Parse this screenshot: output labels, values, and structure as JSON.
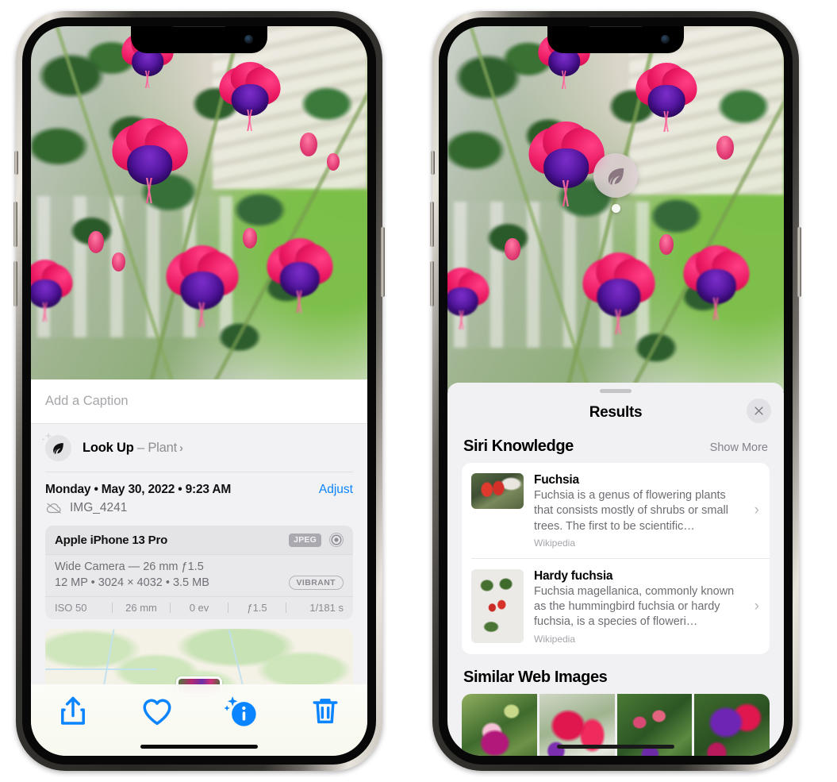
{
  "left_phone": {
    "photo": {
      "alt": "fuchsia-flowers-photo"
    },
    "caption": {
      "placeholder": "Add a Caption",
      "value": ""
    },
    "look_up": {
      "icon": "leaf-icon",
      "label": "Look Up",
      "dash": " – ",
      "subject": "Plant",
      "chevron": "›"
    },
    "date_row": {
      "date_text": "Monday • May 30, 2022 • 9:23 AM",
      "adjust_label": "Adjust"
    },
    "file_row": {
      "icon": "cloud-slash-icon",
      "file_name": "IMG_4241"
    },
    "exif": {
      "device": "Apple iPhone 13 Pro",
      "format_badge": "JPEG",
      "lens_icon": "lens-aperture-icon",
      "lens_line": "Wide Camera — 26 mm ƒ1.5",
      "size_line": "12 MP • 3024 × 4032 • 3.5 MB",
      "style_badge": "VIBRANT",
      "stats": [
        "ISO 50",
        "26 mm",
        "0 ev",
        "ƒ1.5",
        "1/181 s"
      ]
    },
    "map": {
      "pin_label": "photo-pin"
    },
    "toolbar": [
      {
        "name": "share-button",
        "icon": "share-icon"
      },
      {
        "name": "favorite-button",
        "icon": "heart-icon"
      },
      {
        "name": "info-button",
        "icon": "info-sparkle-icon"
      },
      {
        "name": "delete-button",
        "icon": "trash-icon"
      }
    ]
  },
  "right_phone": {
    "vision_badge": {
      "icon": "leaf-icon"
    },
    "sheet": {
      "grabber": "drag-handle",
      "title": "Results",
      "close_icon": "close-icon"
    },
    "siri_knowledge": {
      "title": "Siri Knowledge",
      "action": "Show More",
      "items": [
        {
          "title": "Fuchsia",
          "snippet": "Fuchsia is a genus of flowering plants that consists mostly of shrubs or small trees. The first to be scientific…",
          "source": "Wikipedia",
          "thumb": "fuchsia-red-flowers-thumb",
          "chevron": "›"
        },
        {
          "title": "Hardy fuchsia",
          "snippet": "Fuchsia magellanica, commonly known as the hummingbird fuchsia or hardy fuchsia, is a species of floweri…",
          "source": "Wikipedia",
          "thumb": "hardy-fuchsia-specimen-thumb",
          "chevron": "›"
        }
      ]
    },
    "similar_web_images": {
      "title": "Similar Web Images",
      "thumbs": [
        "fuchsia-web-image-1",
        "fuchsia-web-image-2",
        "fuchsia-web-image-3",
        "fuchsia-web-image-4"
      ]
    }
  },
  "colors": {
    "accent_blue": "#0a84ff",
    "sheet_gray": "#f1f1f4",
    "card_white": "#ffffff",
    "secondary_text": "#8e8e93"
  }
}
